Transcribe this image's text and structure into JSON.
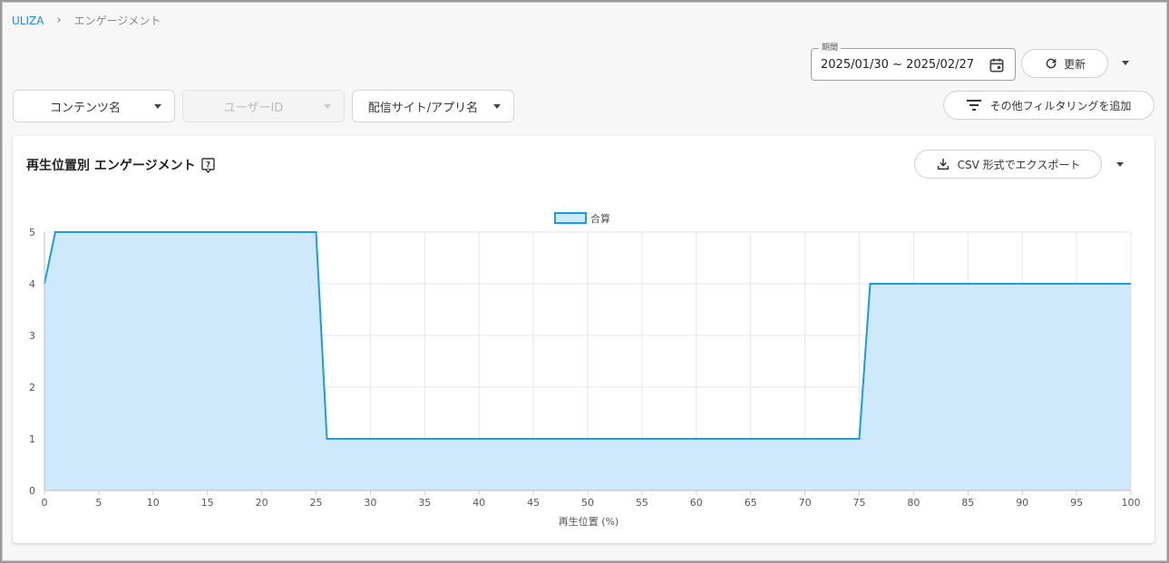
{
  "breadcrumb": {
    "root": "ULIZA",
    "separator": "›",
    "current": "エンゲージメント"
  },
  "period": {
    "label": "期間",
    "value": "2025/01/30 ~ 2025/02/27"
  },
  "toolbar": {
    "refresh_label": "更新"
  },
  "filters": {
    "content_name": "コンテンツ名",
    "user_id": "ユーザーID",
    "site_app": "配信サイト/アプリ名",
    "add_filter": "その他フィルタリングを追加"
  },
  "card": {
    "title": "再生位置別 エンゲージメント",
    "export_label": "CSV 形式でエクスポート"
  },
  "colors": {
    "accent": "#1e88e5",
    "line": "#1a9be3",
    "fill": "#cde9fb"
  },
  "chart_data": {
    "type": "area",
    "legend": [
      "合算"
    ],
    "legend_position": "top-center",
    "xlabel": "再生位置 (%)",
    "ylabel": "",
    "xlim": [
      0,
      100
    ],
    "ylim": [
      0,
      5
    ],
    "x_ticks": [
      0,
      5,
      10,
      15,
      20,
      25,
      30,
      35,
      40,
      45,
      50,
      55,
      60,
      65,
      70,
      75,
      80,
      85,
      90,
      95,
      100
    ],
    "y_ticks": [
      0,
      1,
      2,
      3,
      4,
      5
    ],
    "grid": true,
    "series": [
      {
        "name": "合算",
        "x": [
          0,
          1,
          25,
          26,
          75,
          76,
          100
        ],
        "y": [
          4,
          5,
          5,
          1,
          1,
          4,
          4
        ]
      }
    ]
  }
}
